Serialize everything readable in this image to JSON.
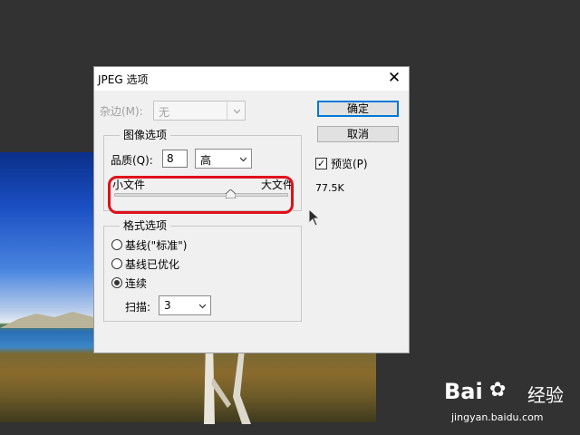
{
  "dialog": {
    "title": "JPEG 选项",
    "close_icon": "close-icon",
    "matte": {
      "label": "杂边(M):",
      "value": "无"
    },
    "image_options": {
      "legend": "图像选项",
      "quality_label": "品质(Q):",
      "quality_value": "8",
      "quality_preset": "高",
      "small_file_label": "小文件",
      "large_file_label": "大文件",
      "slider_value_fraction": 0.67
    },
    "format_options": {
      "legend": "格式选项",
      "options": [
        "基线(\"标准\")",
        "基线已优化",
        "连续"
      ],
      "selected_index": 2,
      "scans_label": "扫描:",
      "scans_value": "3"
    },
    "buttons": {
      "ok": "确定",
      "cancel": "取消"
    },
    "preview": {
      "label": "预览(P)",
      "checked": true,
      "checkmark": "✓"
    },
    "file_size": "77.5K"
  },
  "watermark": {
    "logo_text": "Bai",
    "logo_suffix": "经验",
    "url": "jingyan.baidu.com"
  },
  "colors": {
    "highlight": "#e0101a",
    "default_button_border": "#0078d7",
    "canvas_background": "#323232"
  }
}
